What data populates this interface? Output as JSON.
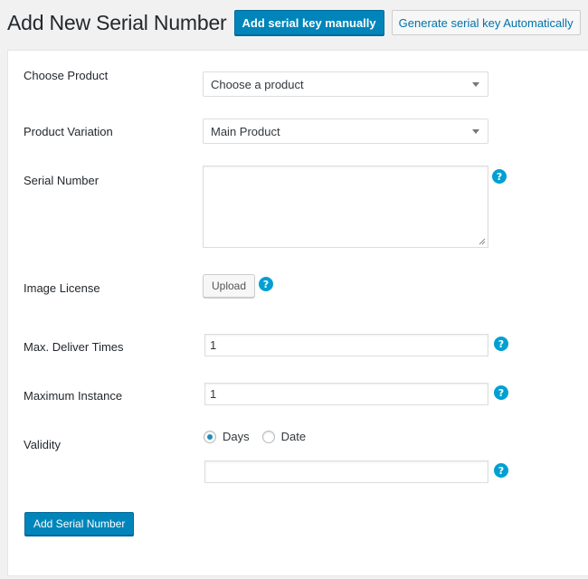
{
  "header": {
    "title": "Add New Serial Number",
    "manual_button": "Add serial key manually",
    "auto_button": "Generate serial key Automatically"
  },
  "form": {
    "product": {
      "label": "Choose Product",
      "value": "Choose a product"
    },
    "variation": {
      "label": "Product Variation",
      "value": "Main Product"
    },
    "serial": {
      "label": "Serial Number",
      "value": "",
      "help": "?"
    },
    "image_license": {
      "label": "Image License",
      "button": "Upload",
      "help": "?"
    },
    "max_deliver": {
      "label": "Max. Deliver Times",
      "value": "1",
      "help": "?"
    },
    "max_instance": {
      "label": "Maximum Instance",
      "value": "1",
      "help": "?"
    },
    "validity": {
      "label": "Validity",
      "options": [
        "Days",
        "Date"
      ],
      "selected": "Days",
      "value": "",
      "help": "?"
    },
    "submit": "Add Serial Number"
  },
  "colors": {
    "primary": "#0085ba",
    "help": "#00a0d2",
    "link": "#0073aa"
  },
  "icons": [
    "dropdown-caret-icon",
    "help-icon",
    "resize-grip-icon"
  ]
}
